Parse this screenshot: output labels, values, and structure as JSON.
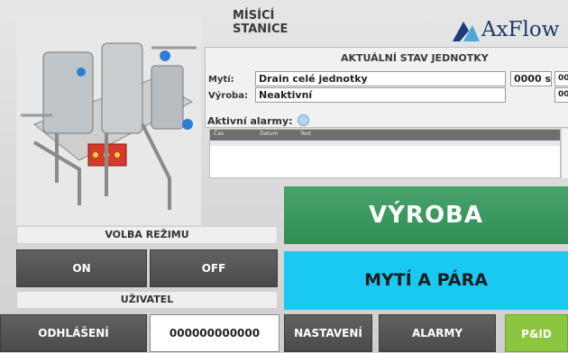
{
  "header": {
    "title": "MÍSÍCÍ STANICE",
    "logo_text": "AxFlow"
  },
  "status": {
    "title": "AKTUÁLNÍ STAV JEDNOTKY",
    "myti_label": "Mytí:",
    "myti_value": "Drain celé jednotky",
    "myti_time": "0000 s",
    "myti_extra": "00",
    "vyroba_label": "Výroba:",
    "vyroba_value": "Neaktivní",
    "vyroba_extra": "00"
  },
  "alarms": {
    "label": "Aktivní alarmy:",
    "columns": [
      "Čas",
      "Datum",
      "Text"
    ]
  },
  "mode": {
    "label": "VOLBA REŽIMU",
    "on": "ON",
    "off": "OFF"
  },
  "user": {
    "label": "UŽIVATEL",
    "logout": "ODHLÁŠENÍ",
    "id_value": "000000000000"
  },
  "main_buttons": {
    "vyroba": "VÝROBA",
    "myti_para": "MYTÍ A PÁRA"
  },
  "nav": {
    "nastaveni": "NASTAVENÍ",
    "alarmy": "ALARMY",
    "pid": "P&ID"
  },
  "colors": {
    "green": "#3a9a5c",
    "cyan": "#19c9f2",
    "pid_green": "#8cc640",
    "dark_button": "#525252"
  }
}
